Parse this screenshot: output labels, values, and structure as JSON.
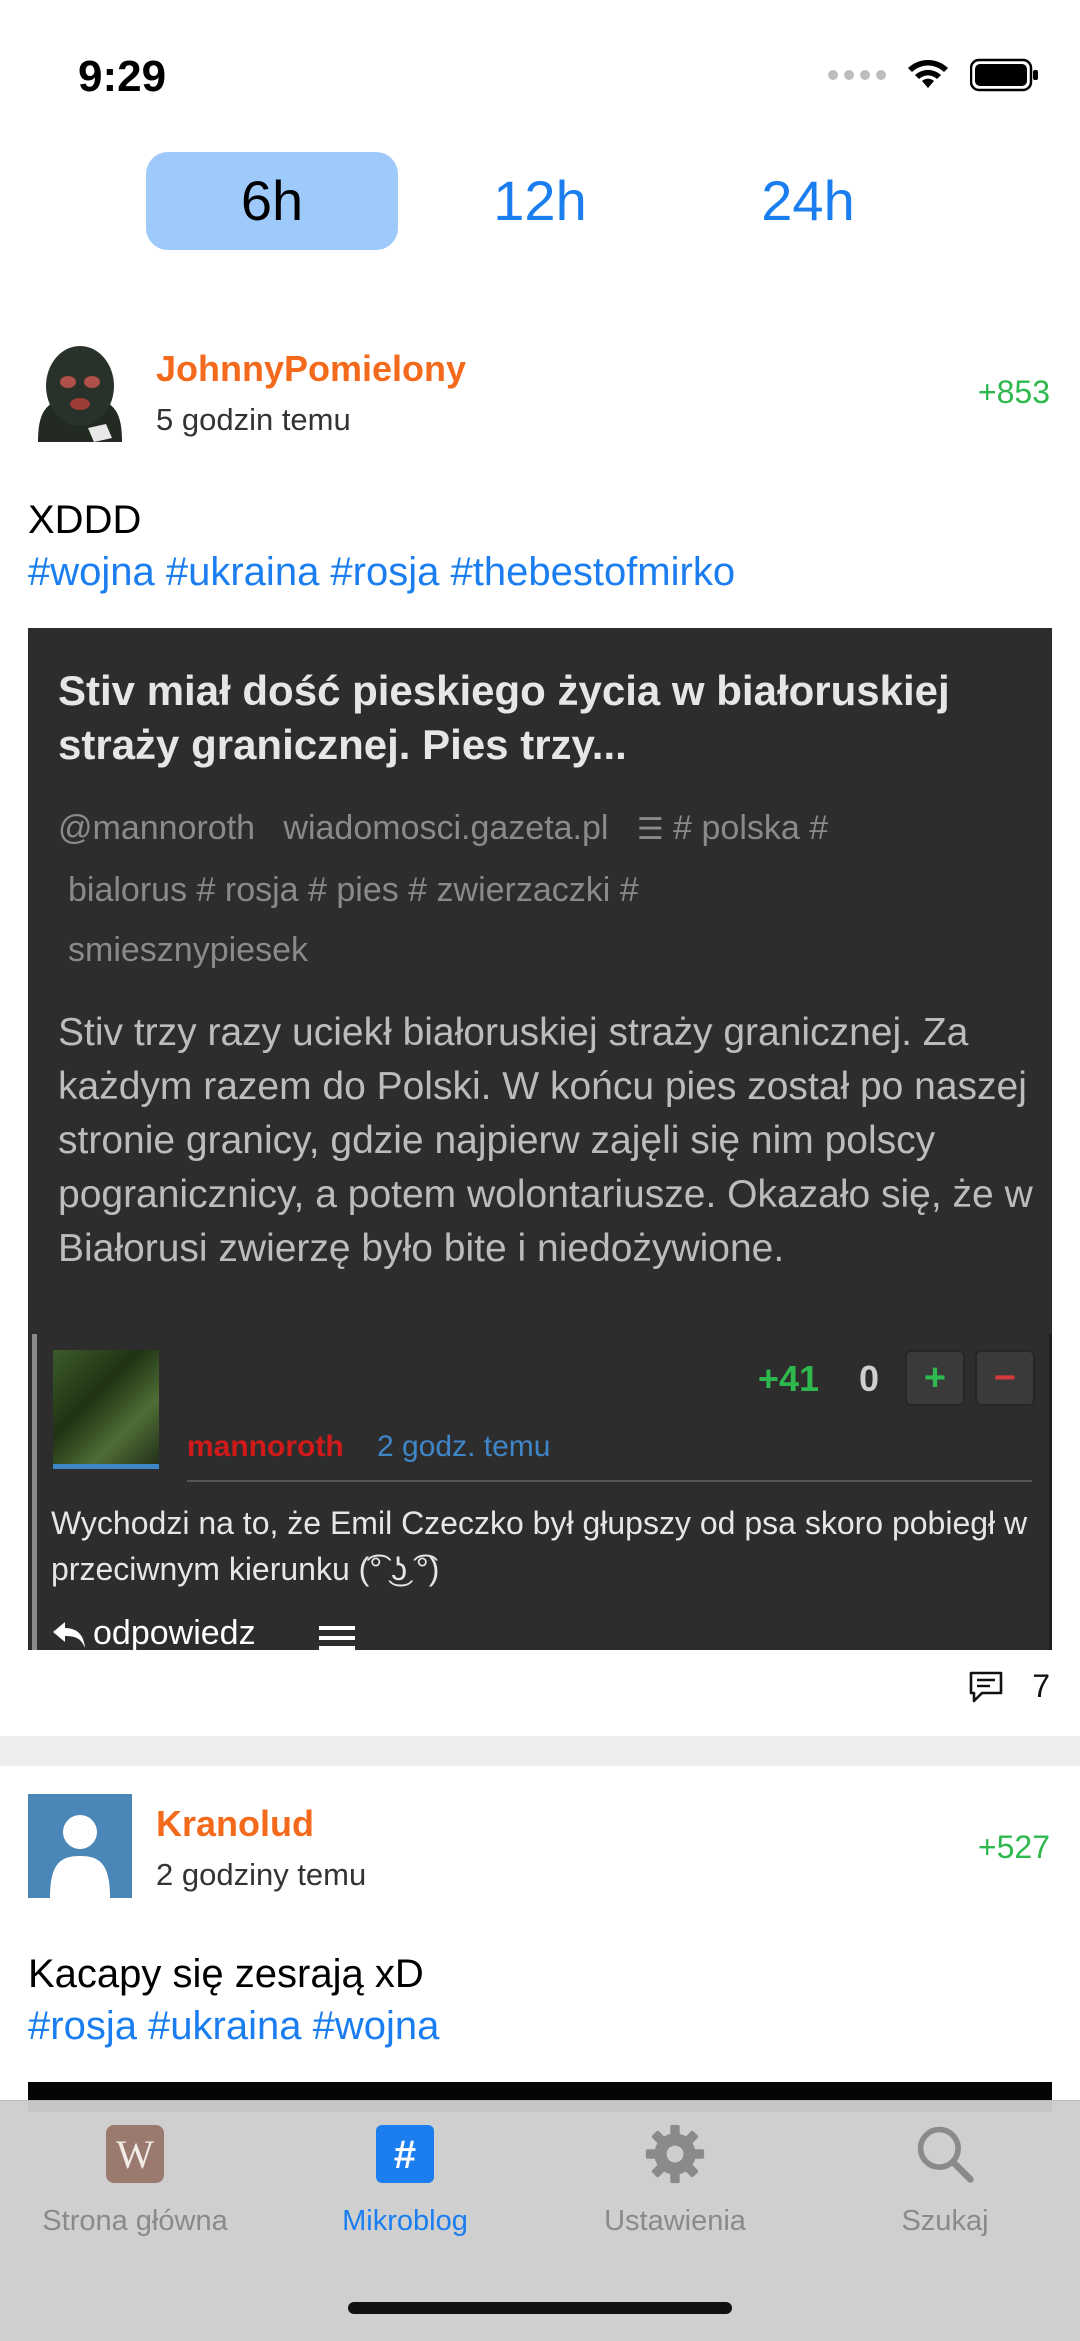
{
  "status_bar": {
    "time": "9:29"
  },
  "segments": [
    {
      "label": "6h",
      "active": true
    },
    {
      "label": "12h",
      "active": false
    },
    {
      "label": "24h",
      "active": false
    }
  ],
  "posts": [
    {
      "username": "JohnnyPomielony",
      "time_ago": "5 godzin temu",
      "score": "+853",
      "text": "XDDD",
      "tags": "#wojna #ukraina #rosja #thebestofmirko",
      "comments_count": "7",
      "embed": {
        "title": "Stiv miał dość pieskiego życia w białoruskiej straży granicznej. Pies trzy...",
        "meta_author": "@mannoroth",
        "meta_domain": "wiadomosci.gazeta.pl",
        "meta_tags_1": "# polska  #",
        "meta_tags_2": "bialorus  # rosja  # pies  # zwierzaczki  #",
        "meta_tags_3": "smiesznypiesek",
        "description": "Stiv trzy razy uciekł białoruskiej straży granicznej. Za każdym razem do Polski. W końcu pies został po naszej stronie granicy, gdzie najpierw zajęli się nim polscy pogranicznicy, a potem wolontariusze. Okazało się, że w Białorusi zwierzę było bite i niedożywione.",
        "comment": {
          "score_plus": "+41",
          "score_zero": "0",
          "vote_up": "+",
          "vote_down": "−",
          "user": "mannoroth",
          "time": "2 godz. temu",
          "text": "Wychodzi na to, że Emil Czeczko był głupszy od psa skoro pobiegł w przeciwnym kierunku (͡° ͜ʖ ͡°)",
          "reply_label": "odpowiedz"
        }
      }
    },
    {
      "username": "Kranolud",
      "time_ago": "2 godziny temu",
      "score": "+527",
      "text": "Kacapy się zesrają xD",
      "tags": "#rosja #ukraina #wojna"
    }
  ],
  "tabbar": [
    {
      "label": "Strona główna",
      "icon": "wykop-logo-icon",
      "active": false
    },
    {
      "label": "Mikroblog",
      "icon": "hashtag-icon",
      "active": true
    },
    {
      "label": "Ustawienia",
      "icon": "gear-icon",
      "active": false
    },
    {
      "label": "Szukaj",
      "icon": "search-icon",
      "active": false
    }
  ],
  "colors": {
    "accent": "#1a7ef0",
    "username": "#f36a1d",
    "score": "#2fb84e",
    "segment_active_bg": "#9ec9fb",
    "embed_bg": "#2d2d2d"
  }
}
